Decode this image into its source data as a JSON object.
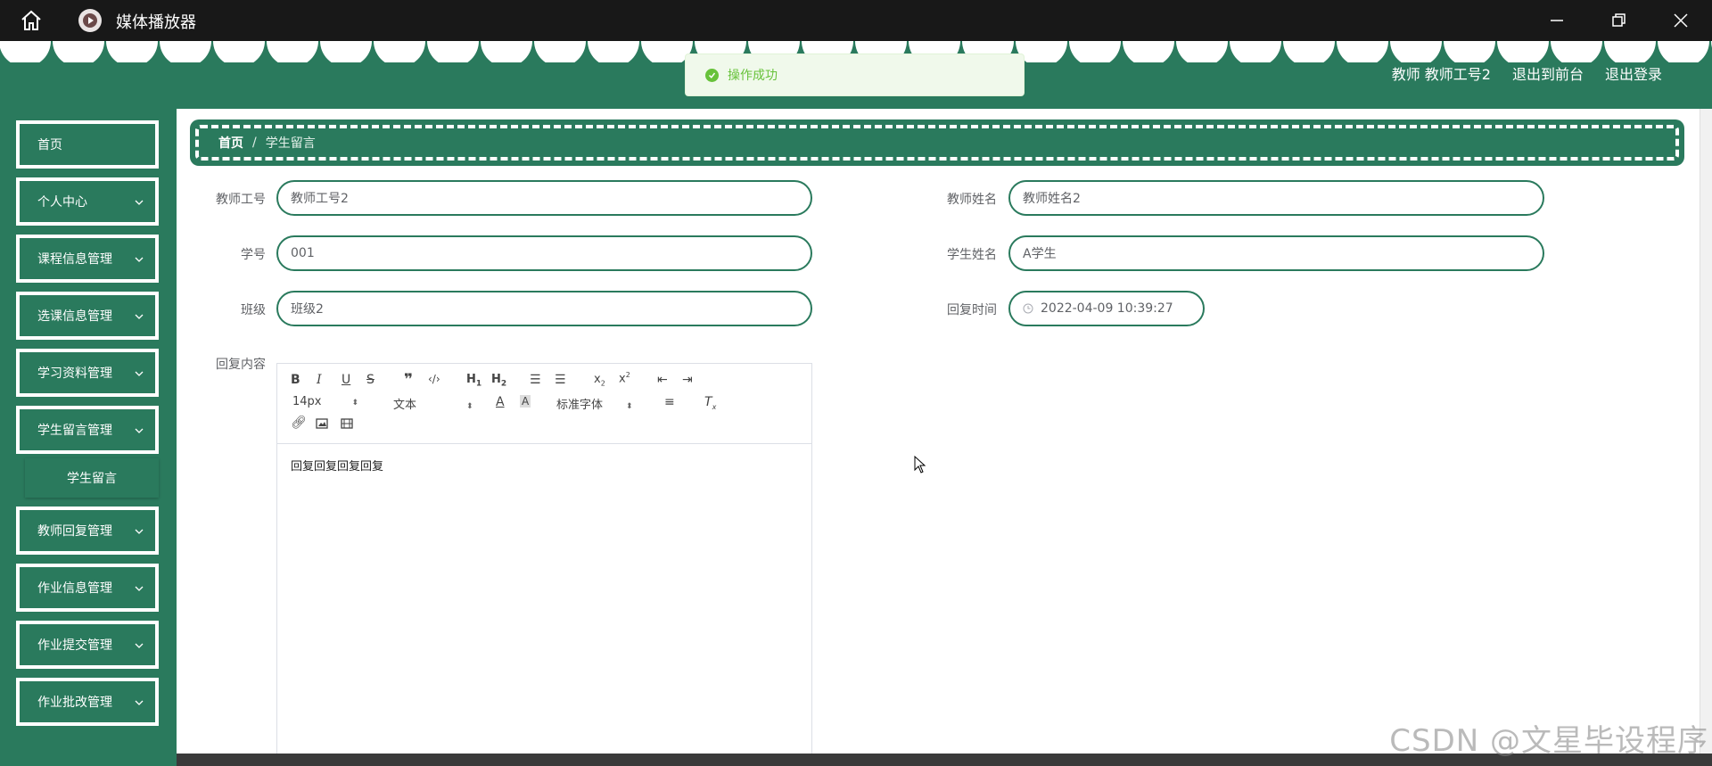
{
  "window": {
    "title": "媒体播放器",
    "controls": [
      "minimize",
      "restore",
      "close"
    ]
  },
  "header": {
    "user_label": "教师 教师工号2",
    "goto_front": "退出到前台",
    "logout": "退出登录"
  },
  "toast": {
    "message": "操作成功",
    "icon": "success-icon"
  },
  "sidebar": {
    "items": [
      {
        "label": "首页",
        "has_children": false
      },
      {
        "label": "个人中心",
        "has_children": true
      },
      {
        "label": "课程信息管理",
        "has_children": true
      },
      {
        "label": "选课信息管理",
        "has_children": true
      },
      {
        "label": "学习资料管理",
        "has_children": true
      },
      {
        "label": "学生留言管理",
        "has_children": true,
        "expanded": true
      },
      {
        "label": "教师回复管理",
        "has_children": true
      },
      {
        "label": "作业信息管理",
        "has_children": true
      },
      {
        "label": "作业提交管理",
        "has_children": true
      },
      {
        "label": "作业批改管理",
        "has_children": true
      }
    ],
    "sub_item": "学生留言"
  },
  "breadcrumb": {
    "home": "首页",
    "separator": "/",
    "current": "学生留言"
  },
  "form": {
    "teacher_id": {
      "label": "教师工号",
      "value": "教师工号2"
    },
    "teacher_name": {
      "label": "教师姓名",
      "value": "教师姓名2"
    },
    "student_id": {
      "label": "学号",
      "value": "001"
    },
    "student_name": {
      "label": "学生姓名",
      "value": "A学生"
    },
    "class": {
      "label": "班级",
      "value": "班级2"
    },
    "reply_time": {
      "label": "回复时间",
      "value": "2022-04-09 10:39:27"
    },
    "reply_content": {
      "label": "回复内容",
      "value": "回复回复回复回复"
    }
  },
  "editor_toolbar": {
    "font_size": "14px",
    "header_select": "文本",
    "font_family": "标准字体",
    "buttons": [
      "bold-icon",
      "italic-icon",
      "underline-icon",
      "strike-icon",
      "blockquote-icon",
      "code-block-icon",
      "h1-icon",
      "h2-icon",
      "ordered-list-icon",
      "bullet-list-icon",
      "subscript-icon",
      "superscript-icon",
      "outdent-icon",
      "indent-icon",
      "font-color-icon",
      "background-color-icon",
      "align-icon",
      "clean-icon",
      "link-icon",
      "image-icon",
      "video-icon"
    ]
  },
  "watermark": "CSDN @文星毕设程序",
  "colors": {
    "primary": "#2a7a5d",
    "titlebar": "#181818",
    "toast_bg": "#f0f9eb",
    "toast_text": "#67c23a"
  }
}
